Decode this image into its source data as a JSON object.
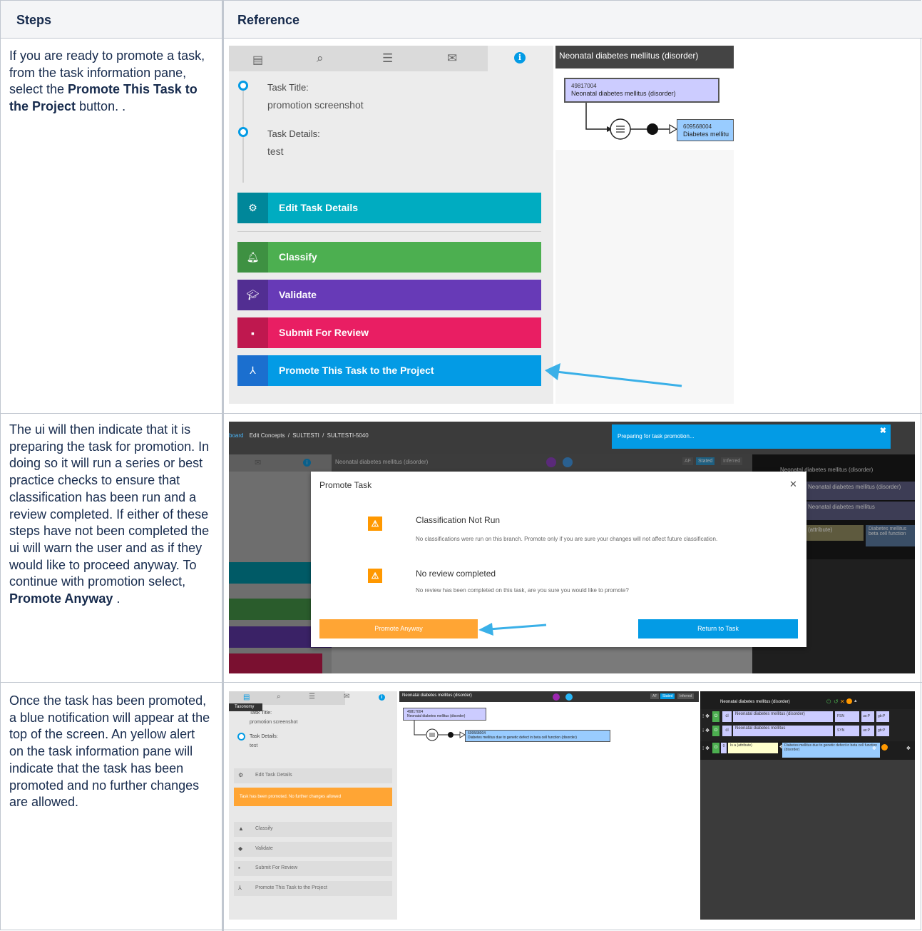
{
  "table": {
    "headers": [
      "Steps",
      "Reference"
    ],
    "rows": [
      {
        "text_parts": [
          "If you are ready to promote a task, from the task information pane, select the ",
          "Promote This Task to the Project",
          " button. ."
        ]
      },
      {
        "text_parts": [
          "The ui will then indicate that it is preparing the task for promotion. In doing so it will run a series or best practice checks to ensure that classification has been run and a review completed. If either of these steps have not been completed the ui will warn the user and as if they would like to proceed anyway. To continue with promotion select, ",
          "Promote Anyway",
          " ."
        ]
      },
      {
        "text_parts": [
          "Once the task has been promoted, a blue notification will appear at the top of the screen. An yellow alert on the task information pane will indicate that the task has been promoted and no further changes are allowed."
        ]
      }
    ]
  },
  "shot1": {
    "task_title_label": "Task Title:",
    "task_title_value": "promotion screenshot",
    "task_details_label": "Task Details:",
    "task_details_value": "test",
    "buttons": {
      "edit": "Edit Task Details",
      "classify": "Classify",
      "validate": "Validate",
      "submit": "Submit For Review",
      "promote": "Promote This Task to the Project"
    },
    "diagram_header": "Neonatal diabetes mellitus (disorder)",
    "concept_id": "49817004",
    "concept_name": "Neonatal diabetes mellitus (disorder)",
    "target_id": "609568004",
    "target_name": "Diabetes mellitu"
  },
  "shot2": {
    "breadcrumb": [
      "board",
      "Edit Concepts",
      "SULTESTI",
      "SULTESTI-5040"
    ],
    "notification": "Preparing for task promotion...",
    "bg_header": "Neonatal diabetes mellitus (disorder)",
    "bg_tabs": [
      "AF",
      "Stated",
      "Inferred"
    ],
    "bg_right_title": "Neonatal diabetes mellitus (disorder)",
    "bg_right_rows": [
      "Neonatal diabetes mellitus (disorder)",
      "Neonatal diabetes mellitus"
    ],
    "bg_attr": "(attribute)",
    "bg_attr_value": "Diabetes mellitus beta cell function",
    "modal_title": "Promote Task",
    "warn1_title": "Classification Not Run",
    "warn1_text": "No classifications were run on this branch. Promote only if you are sure your changes will not affect future classification.",
    "warn2_title": "No review completed",
    "warn2_text": "No review has been completed on this task, are you sure you would like to promote?",
    "btn_promote": "Promote Anyway",
    "btn_return": "Return to Task"
  },
  "shot3": {
    "tooltip": "Taxonomy",
    "task_title_label": "Task Title:",
    "task_title_value": "promotion screenshot",
    "task_details_label": "Task Details:",
    "task_details_value": "test",
    "edit": "Edit Task Details",
    "alert": "Task has been promoted. No further changes allowed",
    "classify": "Classify",
    "validate": "Validate",
    "submit": "Submit For Review",
    "promote": "Promote This Task to the Project",
    "diagram_header": "Neonatal diabetes mellitus (disorder)",
    "concept_id": "49817004",
    "concept_name": "Neonatal diabetes mellitus (disorder)",
    "target_id": "609568004",
    "target_name": "Diabetes mellitus due to genetic defect in beta cell function (disorder)",
    "tabs": [
      "AF",
      "Stated",
      "Inferred"
    ],
    "right_title": "Neonatal diabetes mellitus (disorder)",
    "rows": [
      {
        "c": "cl",
        "term": "Neonatal diabetes mellitus (disorder)",
        "type": "FSN",
        "a": "us:P",
        "b": "gb:P"
      },
      {
        "c": "cl",
        "term": "Neonatal diabetes mellitus",
        "type": "SYN",
        "a": "us:P",
        "b": "gb:P"
      }
    ],
    "rel_group": "0",
    "rel_type": "Is a (attribute)",
    "rel_target": "Diabetes mellitus due to genetic defect in beta cell function (disorder)"
  },
  "colors": {
    "edit": "#00acc1",
    "classify": "#4caf50",
    "validate": "#673ab7",
    "submit": "#e91e63",
    "promote": "#039be5",
    "orange": "#ffa534",
    "header_bg": "#f4f5f7"
  }
}
